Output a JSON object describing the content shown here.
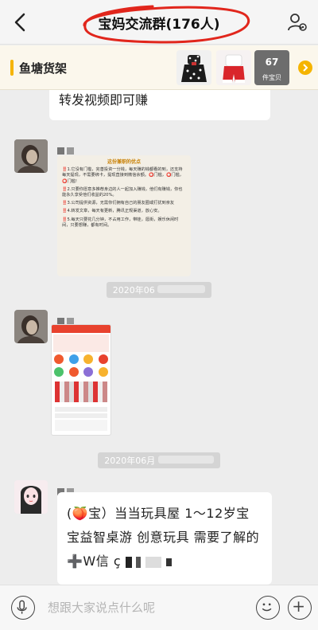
{
  "header": {
    "title": "宝妈交流群(176人)"
  },
  "shelf": {
    "title": "鱼塘货架",
    "count": "67",
    "count_label": "件宝贝"
  },
  "messages": {
    "m0_text": "转发视频即可赚",
    "ts1": "2020年06",
    "ts2": "2020年06月",
    "m3_text": "(🍑宝）当当玩具屋 1～12岁宝宝益智桌游 创意玩具 需要了解的 ➕W信",
    "m3_tail": "ç"
  },
  "poster": {
    "heading": "这份兼职的优点",
    "lines": [
      "‼️1.它没有门槛，完善投资一分钱，每天赚的钱都看的到，还支持每天提现，不需要绑卡，提现直接到微信余额。⭕门槛，⭕门槛，⭕门槛!",
      "‼️2.只要你愿意多推荐身边的人一起加入赚钱，他们有赚钱，你也能永久享受他们收益的20%。",
      "‼️3.公司提供资源，无需你们拥有自己的朋友圈或打扰到亲友",
      "‼️4.转发文章，每天有更新，腾讯正规渠道，放心安。",
      "‼️5.每天只要花几分钟，不占用工作，带娃，逛街，娱乐休闲时间，只要想赚，都有时间。"
    ]
  },
  "input": {
    "placeholder": "想跟大家说点什么呢"
  },
  "colors": {
    "accent": "#f5b400",
    "background": "#ededed",
    "annotation": "#e1261c"
  }
}
